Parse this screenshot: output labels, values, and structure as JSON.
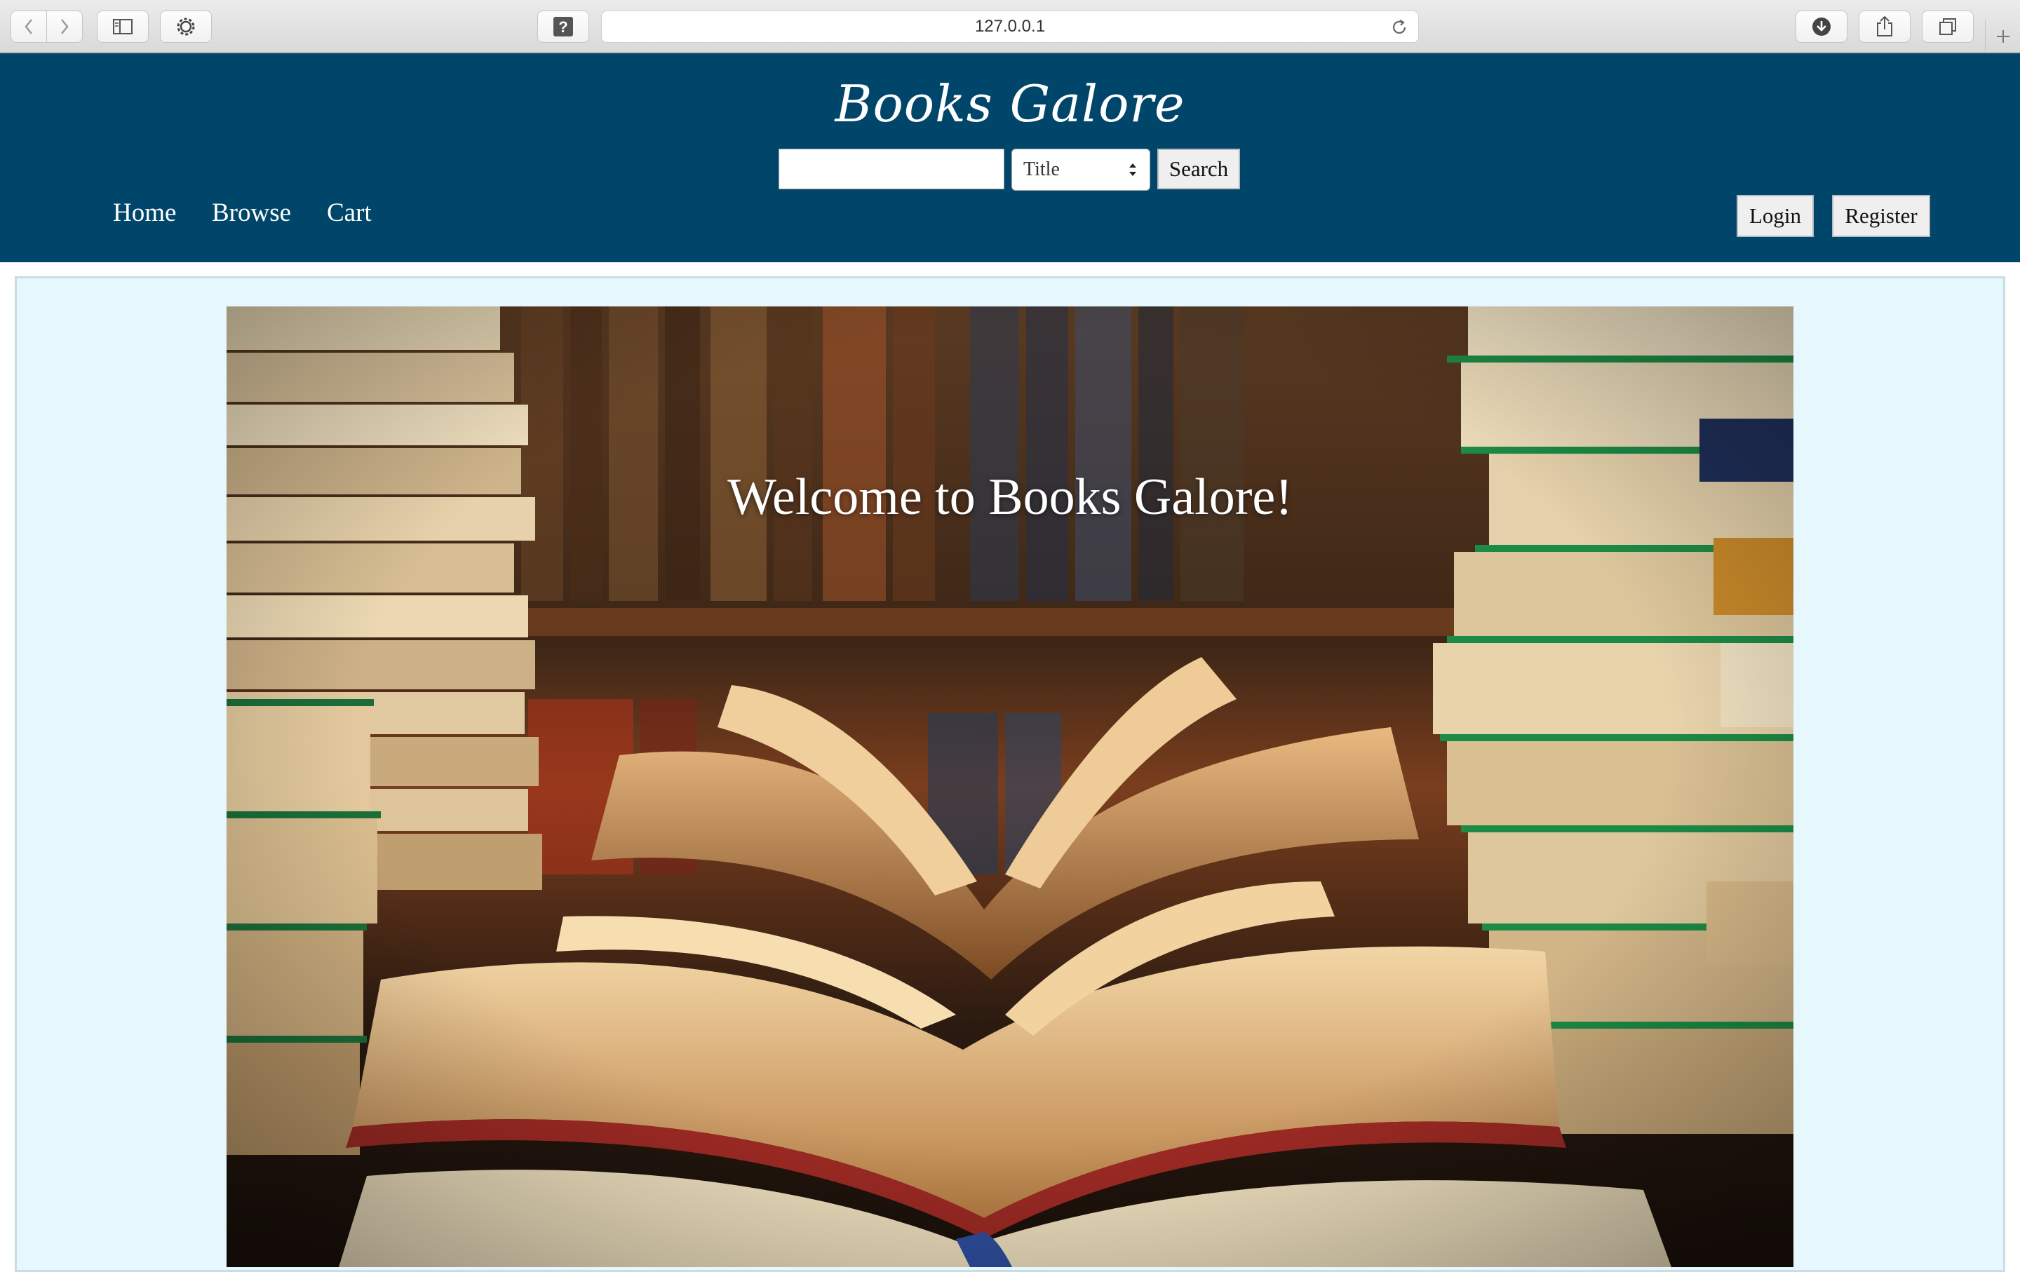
{
  "browser": {
    "url": "127.0.0.1",
    "icons": {
      "back": "chevron-left-icon",
      "forward": "chevron-right-icon",
      "sidebar": "sidebar-icon",
      "settings": "gear-icon",
      "help": "question-icon",
      "reload": "reload-icon",
      "download": "download-icon",
      "share": "share-icon",
      "tabs": "tabs-icon",
      "new_tab": "plus-icon"
    }
  },
  "site": {
    "brand": "Books Galore",
    "search": {
      "placeholder": "",
      "filter_selected": "Title",
      "button_label": "Search"
    },
    "nav": [
      "Home",
      "Browse",
      "Cart"
    ],
    "auth": {
      "login_label": "Login",
      "register_label": "Register"
    }
  },
  "hero": {
    "title": "Welcome to Books Galore!",
    "image": "open books on a table in front of bookshelves"
  },
  "colors": {
    "header_bg": "#00466a",
    "content_bg": "#e6f8fd",
    "header_text": "#ffffff"
  }
}
